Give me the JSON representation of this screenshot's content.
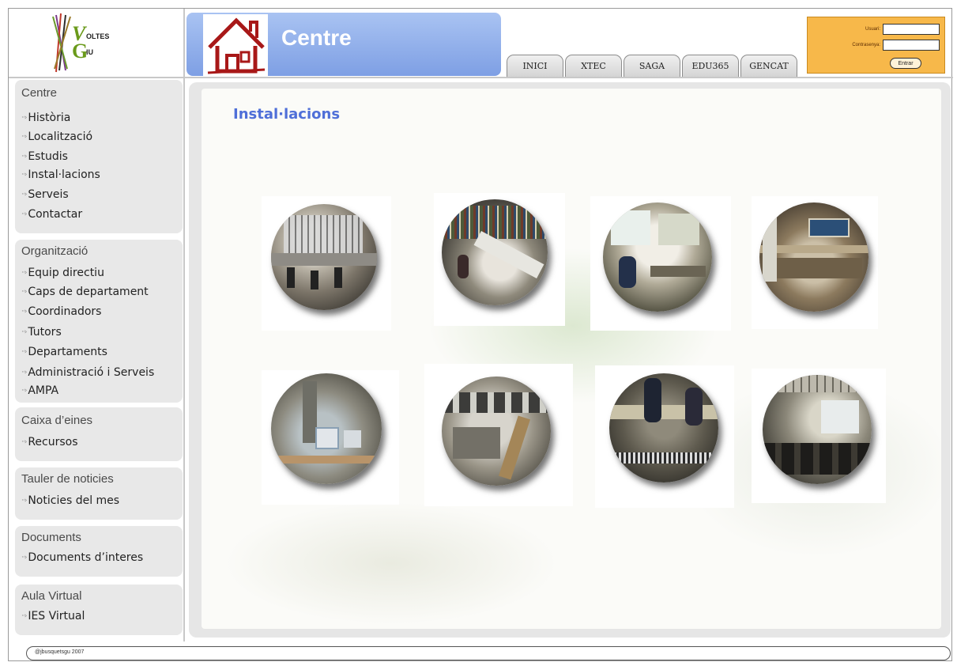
{
  "logo": {
    "line1": "OLTES",
    "line2": "IU",
    "initial1": "V",
    "initial2": "G"
  },
  "header": {
    "title": "Centre"
  },
  "tabs": [
    "INICI",
    "XTEC",
    "SAGA",
    "EDU365",
    "GENCAT"
  ],
  "login": {
    "user_label": "Usuari:",
    "password_label": "Contrasenya:",
    "button": "Entrar",
    "user_value": "",
    "password_value": ""
  },
  "sidebar": {
    "centre": {
      "title": "Centre",
      "items": [
        "Història",
        "Localització",
        "Estudis",
        "Instal·lacions",
        "Serveis",
        "Contactar"
      ]
    },
    "organitzacio": {
      "title": "Organització",
      "items": [
        "Equip directiu",
        "Caps de departament",
        "Coordinadors",
        "Tutors",
        "Departaments",
        "Administració i Serveis",
        "AMPA"
      ]
    },
    "caixa": {
      "title": "Caixa d’eines",
      "items": [
        "Recursos"
      ]
    },
    "tauler": {
      "title": "Tauler de noticies",
      "items": [
        "Noticies del mes"
      ]
    },
    "documents": {
      "title": "Documents",
      "items": [
        "Documents d’interes"
      ]
    },
    "aula": {
      "title": "Aula Virtual",
      "items": [
        "IES Virtual"
      ]
    }
  },
  "main": {
    "title": "Instal·lacions"
  },
  "footer": {
    "text": "@jbusquetsgu 2007"
  },
  "colors": {
    "banner": "#8aa9e8",
    "title": "#4f6fd8",
    "login_bg": "#f7b84a"
  }
}
